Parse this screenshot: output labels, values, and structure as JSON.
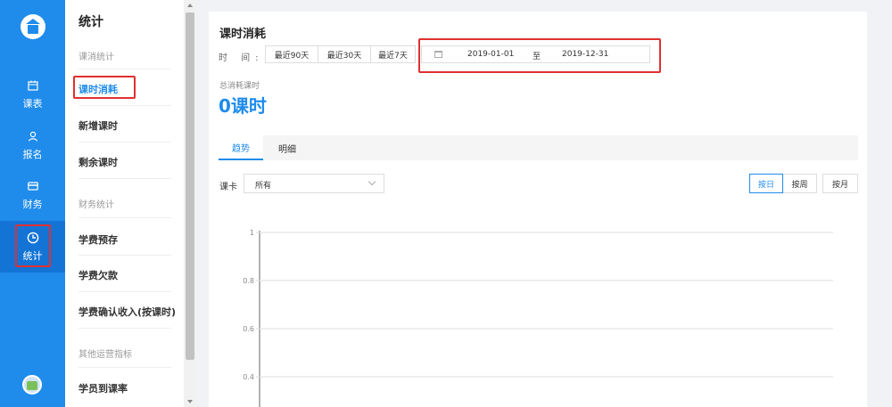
{
  "rail": {
    "items": [
      {
        "label": "课表",
        "icon": "calendar-icon"
      },
      {
        "label": "报名",
        "icon": "user-icon"
      },
      {
        "label": "财务",
        "icon": "wallet-icon"
      },
      {
        "label": "统计",
        "icon": "clock-icon",
        "active": true
      }
    ]
  },
  "submenu": {
    "title": "统计",
    "groups": {
      "course": "课消统计",
      "finance": "财务统计",
      "other": "其他运营指标"
    },
    "items": {
      "consumption": "课时消耗",
      "new_hours": "新增课时",
      "remaining": "剩余课时",
      "prepaid": "学费预存",
      "owed": "学费欠款",
      "confirmed": "学费确认收入(按课时)",
      "attendance": "学员到课率"
    }
  },
  "main": {
    "title": "课时消耗",
    "time_label": "时 间:",
    "ranges": [
      "最近90天",
      "最近30天",
      "最近7天"
    ],
    "date_start": "2019-01-01",
    "date_sep": "至",
    "date_end": "2019-12-31",
    "total_label": "总消耗课时",
    "total_value": "0课时",
    "tabs": [
      "趋势",
      "明细"
    ],
    "card_label": "课卡",
    "card_value": "所有",
    "group_by": [
      "按日",
      "按周",
      "按月"
    ]
  },
  "chart_data": {
    "type": "line",
    "yticks": [
      "1",
      "0.8",
      "0.6",
      "0.4"
    ],
    "series": [],
    "grid": true
  },
  "colors": {
    "primary": "#1f8ceb",
    "highlight": "#e03030"
  }
}
